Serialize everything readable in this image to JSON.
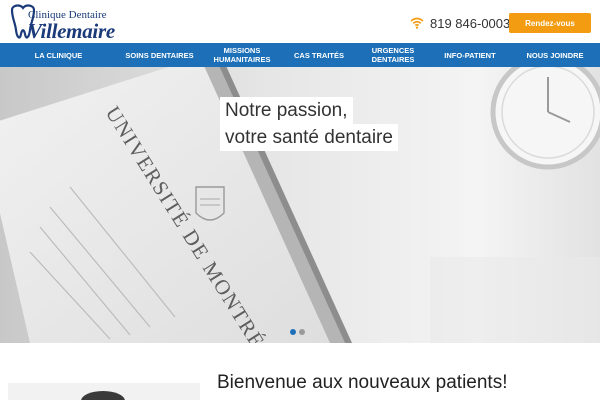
{
  "header": {
    "logo": {
      "line1": "Clinique Dentaire",
      "line2": "Villemaire",
      "icon": "tooth-logo-icon"
    },
    "phone": {
      "icon": "wifi-signal-icon",
      "number": "819 846-0003"
    },
    "appointment_button": "Rendez-vous"
  },
  "nav": {
    "items": [
      {
        "label": "LA CLINIQUE"
      },
      {
        "label": "SOINS DENTAIRES"
      },
      {
        "label": "MISSIONS HUMANITAIRES"
      },
      {
        "label": "CAS TRAITÉS"
      },
      {
        "label": "URGENCES DENTAIRES"
      },
      {
        "label": "INFO-PATIENT"
      },
      {
        "label": "NOUS JOINDRE"
      }
    ]
  },
  "hero": {
    "line1": "Notre passion,",
    "line2": "votre santé dentaire",
    "diploma_text": "UNIVERSITÉ DE MONTRÉAL",
    "slides": 2,
    "active_slide": 1
  },
  "welcome": {
    "title": "Bienvenue aux nouveaux patients!"
  },
  "colors": {
    "nav": "#1d70b8",
    "accent": "#f39c12",
    "logo": "#1b3a7a"
  }
}
